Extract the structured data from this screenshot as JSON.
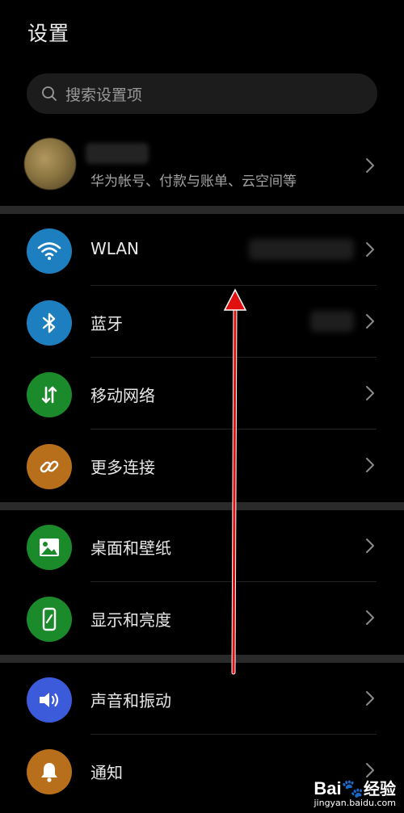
{
  "header": {
    "title": "设置"
  },
  "search": {
    "placeholder": "搜索设置项"
  },
  "account": {
    "subtitle": "华为帐号、付款与账单、云空间等"
  },
  "groups": [
    {
      "items": [
        {
          "label": "WLAN",
          "icon": "wifi-icon",
          "color": "#1e7fc0"
        },
        {
          "label": "蓝牙",
          "icon": "bluetooth-icon",
          "color": "#1e7fc0"
        },
        {
          "label": "移动网络",
          "icon": "mobile-data-icon",
          "color": "#1a8a2a"
        },
        {
          "label": "更多连接",
          "icon": "link-icon",
          "color": "#b86f1c"
        }
      ]
    },
    {
      "items": [
        {
          "label": "桌面和壁纸",
          "icon": "wallpaper-icon",
          "color": "#1a8a2a"
        },
        {
          "label": "显示和亮度",
          "icon": "display-icon",
          "color": "#1a8a2a"
        }
      ]
    },
    {
      "items": [
        {
          "label": "声音和振动",
          "icon": "sound-icon",
          "color": "#3b5bdb"
        },
        {
          "label": "通知",
          "icon": "bell-icon",
          "color": "#b86f1c"
        }
      ]
    }
  ],
  "watermark": {
    "logo": "Bai",
    "logo_suffix": "经验",
    "url": "jingyan.baidu.com"
  }
}
